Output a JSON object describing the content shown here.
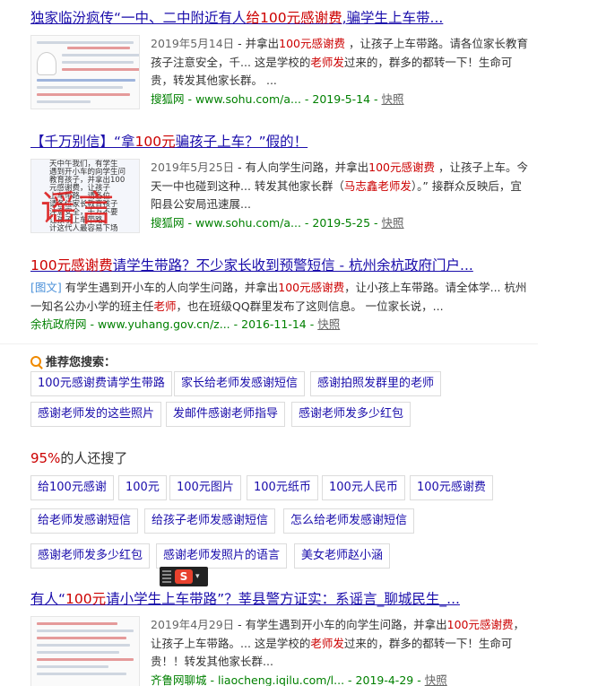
{
  "results": [
    {
      "title_pre": "独家临汾疯传“一中、二中附近有人",
      "title_em": "给100元感谢费",
      "title_post": ",骗学生上车带...",
      "date": "2019年5月14日",
      "abs_a": " - 并拿出",
      "abs_em1": "100元感谢费",
      "abs_b": " ，让孩子上车带路。请各位家长教育孩子注意安全，千... 这是学校的",
      "abs_em2": "老师发",
      "abs_c": "过来的，群多的都转一下！生命可贵，转发其他家长群。 ...",
      "source": "搜狐网 - www.sohu.com/a... - 2019-5-14 - ",
      "snapshot": "快照"
    },
    {
      "title_pre": "【千万别信】“拿",
      "title_em": "100元",
      "title_post": "骗孩子上车？”假的！",
      "date": "2019年5月25日",
      "abs_a": " - 有人向学生问路，并拿出",
      "abs_em1": "100元感谢费",
      "abs_b": " ，让孩子上车。今天一中也碰到这种... 转发其他家长群（",
      "abs_em2": "马志鑫老师发",
      "abs_c": "）。” 接群众反映后，宜阳县公安局迅速展...",
      "source": "搜狐网 - www.sohu.com/a... - 2019-5-25 - ",
      "snapshot": "快照",
      "thumb_lines": [
        "天中午我们，有学生",
        "遇到开小车的向学生问",
        "教育孩子，并拿出100",
        "元感谢费，让孩子",
        "上车带路。请各位",
        "请各位家长教育孩子",
        "注意安全，千万不要",
        "让孩子上车带路。",
        "计这代人最容易下场"
      ],
      "stamp": "谣言"
    },
    {
      "title_em": "100元感谢费",
      "title_post": "请学生带路？不少家长收到预警短信 - 杭州余杭政府门户...",
      "tag": "[图文]",
      "abs_a": " 有学生遇到开小车的人向学生问路，并拿出",
      "abs_em1": "100元感谢费",
      "abs_b": "，让小孩上车带路。请全体学... 杭州一知名公办小学的班主任",
      "abs_em2": "老师",
      "abs_c": "，也在班级QQ群里发布了这则信息。 一位家长说，...",
      "source": "余杭政府网 - www.yuhang.gov.cn/z... - 2016-11-14 - ",
      "snapshot": "快照"
    },
    {
      "title_pre": "有人“",
      "title_em": "100元",
      "title_post": "请小学生上车带路”？莘县警方证实：系谣言_聊城民生_...",
      "date": "2019年4月29日",
      "abs_a": " - 有学生遇到开小车的向学生问路，并拿出",
      "abs_em1": "100元感谢费",
      "abs_b": "，让孩子上车带路。... 这是学校的",
      "abs_em2": "老师发",
      "abs_c": "过来的，群多的都转一下！生命可贵！！转发其他家长群...",
      "source": "齐鲁网聊城 - liaocheng.iqilu.com/l... - 2019-4-29 - ",
      "snapshot": "快照"
    }
  ],
  "recommend": {
    "title": "推荐您搜索：",
    "chips": [
      "100元感谢费请学生带路",
      "家长给老师发感谢短信",
      "感谢拍照发群里的老师",
      "感谢老师发的这些照片",
      "发邮件感谢老师指导",
      "感谢老师发多少红包"
    ]
  },
  "also_searched": {
    "percent": "95%",
    "label": "的人还搜了",
    "chips": [
      "给100元感谢",
      "100元",
      "100元图片",
      "100元纸币",
      "100元人民币",
      "100元感谢费",
      "给老师发感谢短信",
      "给孩子老师发感谢短信",
      "怎么给老师发感谢短信",
      "感谢老师发多少红包",
      "感谢老师发照片的语言",
      "美女老师赵小涵"
    ]
  },
  "ime": {
    "logo": "S",
    "arrow": "▾"
  },
  "colors": {
    "link": "#1a0dab",
    "highlight": "#c00",
    "source": "#008000"
  }
}
